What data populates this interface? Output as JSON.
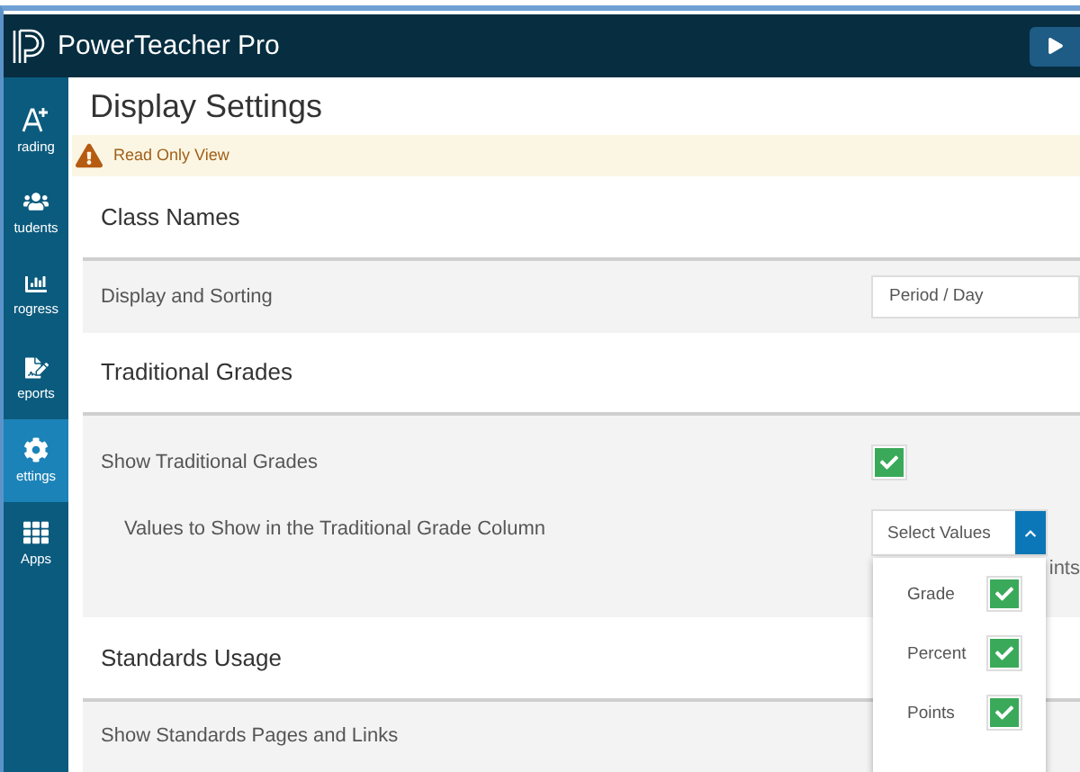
{
  "app": {
    "title": "PowerTeacher Pro"
  },
  "sidebar": {
    "items": [
      {
        "kind": "grade",
        "label": "rading",
        "selected": false
      },
      {
        "kind": "people",
        "label": "tudents",
        "selected": false
      },
      {
        "kind": "chart",
        "label": "rogress",
        "selected": false
      },
      {
        "kind": "report",
        "label": "eports",
        "selected": false
      },
      {
        "kind": "gear",
        "label": "ettings",
        "selected": true
      },
      {
        "kind": "apps",
        "label": "Apps",
        "selected": false
      }
    ]
  },
  "page": {
    "title": "Display Settings",
    "notice": "Read Only View"
  },
  "sections": [
    {
      "kind": "heading",
      "label": "Class Names"
    },
    {
      "kind": "select",
      "label": "Display and Sorting",
      "value": "Period / Day"
    },
    {
      "kind": "heading",
      "label": "Traditional Grades"
    },
    {
      "kind": "check",
      "label": "Show Traditional Grades",
      "checked": true
    },
    {
      "kind": "multi",
      "label": "Values to Show in the Traditional Grade Column",
      "placeholder": "Select Values",
      "expanded": true,
      "summary": "ints",
      "options": [
        {
          "label": "Grade",
          "checked": true
        },
        {
          "label": "Percent",
          "checked": true
        },
        {
          "label": "Points",
          "checked": true
        }
      ]
    },
    {
      "kind": "heading",
      "label": "Standards Usage"
    },
    {
      "kind": "plain",
      "label": "Show Standards Pages and Links"
    }
  ]
}
